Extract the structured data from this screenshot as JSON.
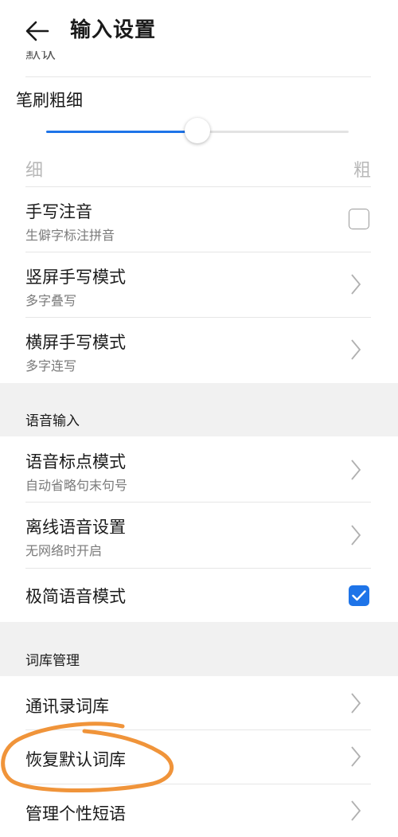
{
  "header": {
    "title": "输入设置"
  },
  "clipped_item": "默认",
  "brush": {
    "label": "笔刷粗细",
    "min_label": "细",
    "max_label": "粗",
    "value_fraction": 0.5
  },
  "items": [
    {
      "id": "handwriting-phonetic",
      "title": "手写注音",
      "subtitle": "生僻字标注拼音",
      "control": "checkbox",
      "checked": false
    },
    {
      "id": "portrait-mode",
      "title": "竖屏手写模式",
      "subtitle": "多字叠写",
      "control": "chevron"
    },
    {
      "id": "landscape-mode",
      "title": "横屏手写模式",
      "subtitle": "多字连写",
      "control": "chevron"
    }
  ],
  "voice_section": {
    "title": "语音输入"
  },
  "voice_items": [
    {
      "id": "voice-punct",
      "title": "语音标点模式",
      "subtitle": "自动省略句末句号",
      "control": "chevron"
    },
    {
      "id": "offline-voice",
      "title": "离线语音设置",
      "subtitle": "无网络时开启",
      "control": "chevron"
    },
    {
      "id": "minimal-voice",
      "title": "极简语音模式",
      "subtitle": "",
      "control": "checkbox",
      "checked": true
    }
  ],
  "lexicon_section": {
    "title": "词库管理"
  },
  "lexicon_items": [
    {
      "id": "contacts-lexicon",
      "title": "通讯录词库",
      "control": "chevron"
    },
    {
      "id": "restore-lexicon",
      "title": "恢复默认词库",
      "control": "chevron"
    },
    {
      "id": "personal-phrases",
      "title": "管理个性短语",
      "control": "chevron"
    }
  ],
  "colors": {
    "accent": "#1e74e8",
    "annotation": "#f0943a",
    "section_bg": "#f1f1f1"
  },
  "icons": {
    "back": "arrow-left-icon",
    "chevron": "chevron-right-icon",
    "check": "check-icon"
  }
}
